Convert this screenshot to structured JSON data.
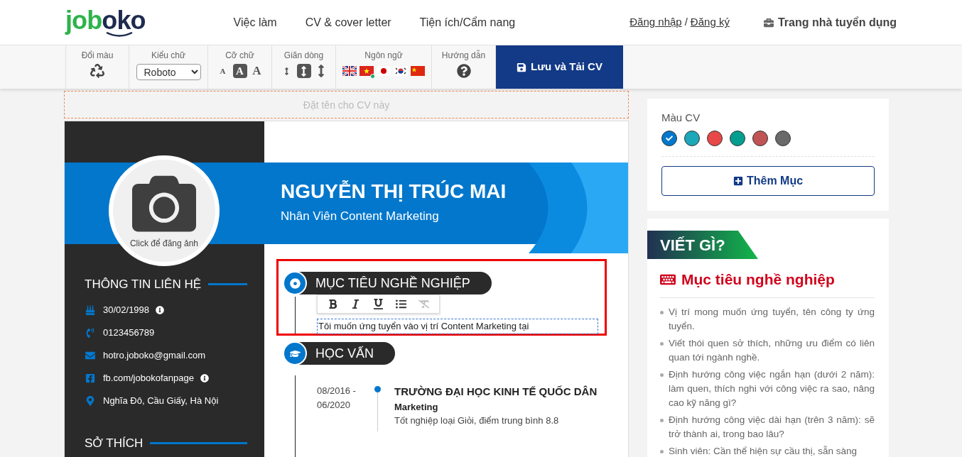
{
  "header": {
    "logo": [
      "job",
      "oko"
    ],
    "nav": [
      "Việc làm",
      "CV & cover letter",
      "Tiện ích/Cẩm nang"
    ],
    "login": "Đăng nhập",
    "separator": "/",
    "register": "Đăng ký",
    "employer": "Trang nhà tuyển dụng"
  },
  "toolbar": {
    "color": {
      "label": "Đổi màu"
    },
    "font": {
      "label": "Kiểu chữ",
      "value": "Roboto"
    },
    "size": {
      "label": "Cỡ chữ",
      "options": [
        {
          "label": "A",
          "selected": false
        },
        {
          "label": "A",
          "selected": true
        },
        {
          "label": "A",
          "selected": false
        }
      ]
    },
    "spacing": {
      "label": "Giãn dòng",
      "options": [
        {
          "selected": false
        },
        {
          "selected": true
        },
        {
          "selected": false
        }
      ]
    },
    "language": {
      "label": "Ngôn ngữ",
      "flags": [
        {
          "kind": "uk",
          "selected": false
        },
        {
          "kind": "vn",
          "selected": true
        },
        {
          "kind": "jp",
          "selected": false
        },
        {
          "kind": "kr",
          "selected": false
        },
        {
          "kind": "cn",
          "selected": false
        }
      ]
    },
    "guide": {
      "label": "Hướng dẫn"
    },
    "save": "Lưu và Tải CV"
  },
  "cv_name": {
    "placeholder": "Đặt tên cho CV này"
  },
  "cv": {
    "photo_caption": "Click để đăng ảnh",
    "name": "NGUYỄN THỊ TRÚC MAI",
    "position": "Nhân Viên Content Marketing",
    "contact": {
      "title": "THÔNG TIN LIÊN HỆ",
      "items": [
        {
          "kind": "birthday",
          "text": "30/02/1998",
          "info": true
        },
        {
          "kind": "phone",
          "text": "0123456789",
          "info": false
        },
        {
          "kind": "email",
          "text": "hotro.joboko@gmail.com",
          "info": false
        },
        {
          "kind": "facebook",
          "text": "fb.com/jobokofanpage",
          "info": true
        },
        {
          "kind": "address",
          "text": "Nghĩa Đô, Cầu Giấy, Hà Nội",
          "info": false
        }
      ]
    },
    "hobbies": {
      "title": "SỞ THÍCH"
    },
    "objective": {
      "title": "MỤC TIÊU NGHỀ NGHIỆP",
      "text": "Tôi muốn ứng tuyển vào vị trí Content Marketing tại",
      "editor": [
        {
          "kind": "bold",
          "disabled": false
        },
        {
          "kind": "italic",
          "disabled": false
        },
        {
          "kind": "underline",
          "disabled": false
        },
        {
          "kind": "list",
          "disabled": false
        },
        {
          "kind": "clear",
          "disabled": true
        }
      ]
    },
    "education": {
      "title": "HỌC VẤN",
      "items": [
        {
          "start": "08/2016 -",
          "end": "06/2020",
          "school": "TRƯỜNG ĐẠI HỌC KINH TẾ QUỐC DÂN",
          "major": "Marketing",
          "detail": "Tốt nghiệp loại Giỏi, điểm trung bình 8.8"
        }
      ]
    }
  },
  "sidebar": {
    "colors": {
      "label": "Màu CV",
      "swatches": [
        {
          "color": "#0277cc",
          "selected": true
        },
        {
          "color": "#1ca8b8",
          "selected": false
        },
        {
          "color": "#e84848",
          "selected": false
        },
        {
          "color": "#039e90",
          "selected": false
        },
        {
          "color": "#c05454",
          "selected": false
        },
        {
          "color": "#6a6a6a",
          "selected": false
        }
      ]
    },
    "add_section": "Thêm Mục",
    "tips": {
      "badge": "VIẾT GÌ?",
      "title": "Mục tiêu nghề nghiệp",
      "items": [
        "Vị trí mong muốn ứng tuyển, tên công ty ứng tuyển.",
        "Viết thói quen sở thích, những ưu điểm có liên quan tới ngành nghề.",
        "Định hướng công việc ngắn hạn (dưới 2 năm): làm quen, thích nghi với công việc ra sao, nâng cao kỹ năng gì?",
        "Định hướng công việc dài hạn (trên 3 năm): sẽ trở thành ai, trong bao lâu?",
        "Sinh viên: Cần thể hiện sự cầu thị, sẵn sàng"
      ]
    }
  }
}
